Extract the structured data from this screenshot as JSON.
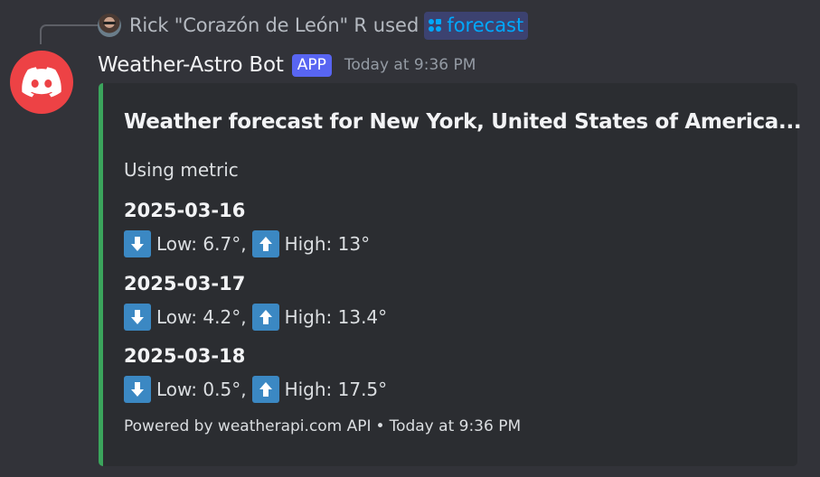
{
  "interaction": {
    "user_name": "Rick \"Corazón de León\" R",
    "used_text": "used",
    "command_name": "forecast",
    "command_icon": "slash-command-icon"
  },
  "message": {
    "bot_name": "Weather-Astro Bot",
    "badge": "APP",
    "timestamp": "Today at 9:36 PM",
    "avatar_icon": "discord-logo-icon",
    "avatar_color": "#ed4245"
  },
  "embed": {
    "accent_color": "#3ba55c",
    "title": "Weather forecast for New York, United States of America...",
    "description": "Using metric",
    "days": [
      {
        "date": "2025-03-16",
        "low": "Low: 6.7°,",
        "high": "High: 13°"
      },
      {
        "date": "2025-03-17",
        "low": "Low: 4.2°,",
        "high": "High: 13.4°"
      },
      {
        "date": "2025-03-18",
        "low": "Low: 0.5°,",
        "high": "High: 17.5°"
      }
    ],
    "footer_text": "Powered by weatherapi.com API",
    "footer_separator": "•",
    "footer_timestamp": "Today at 9:36 PM",
    "icons": {
      "low": "arrow-down-icon",
      "high": "arrow-up-icon"
    }
  }
}
